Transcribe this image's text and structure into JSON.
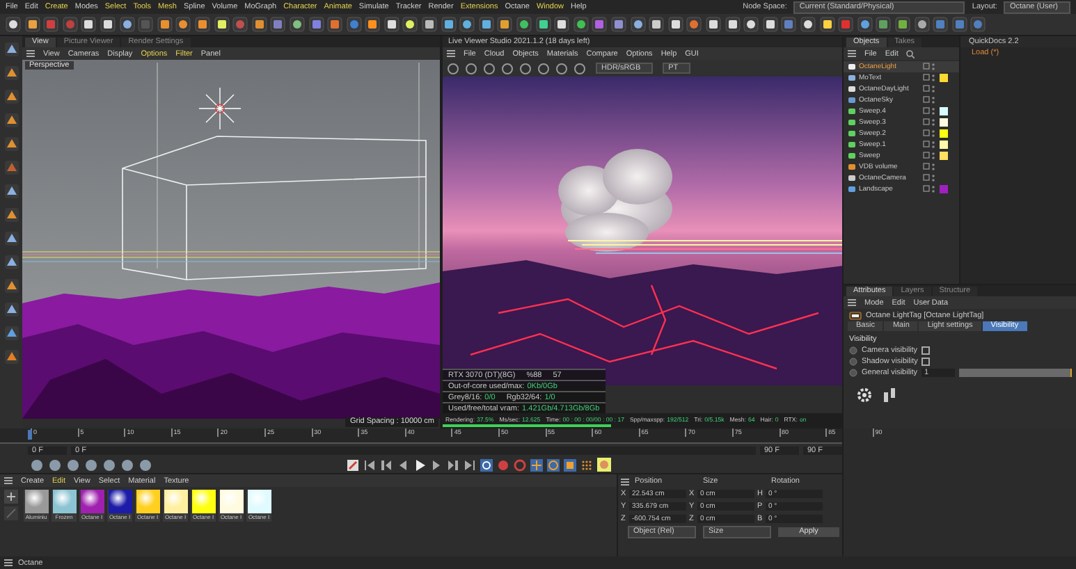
{
  "menu_bar": {
    "items": [
      {
        "label": "File",
        "highlighted": false
      },
      {
        "label": "Edit",
        "highlighted": false
      },
      {
        "label": "Create",
        "highlighted": true
      },
      {
        "label": "Modes",
        "highlighted": false
      },
      {
        "label": "Select",
        "highlighted": true
      },
      {
        "label": "Tools",
        "highlighted": true
      },
      {
        "label": "Mesh",
        "highlighted": true
      },
      {
        "label": "Spline",
        "highlighted": false
      },
      {
        "label": "Volume",
        "highlighted": false
      },
      {
        "label": "MoGraph",
        "highlighted": false
      },
      {
        "label": "Character",
        "highlighted": true
      },
      {
        "label": "Animate",
        "highlighted": true
      },
      {
        "label": "Simulate",
        "highlighted": false
      },
      {
        "label": "Tracker",
        "highlighted": false
      },
      {
        "label": "Render",
        "highlighted": false
      },
      {
        "label": "Extensions",
        "highlighted": true
      },
      {
        "label": "Octane",
        "highlighted": false
      },
      {
        "label": "Window",
        "highlighted": true
      },
      {
        "label": "Help",
        "highlighted": false
      }
    ],
    "node_space": {
      "label": "Node Space:",
      "value": "Current (Standard/Physical)"
    },
    "layout": {
      "label": "Layout:",
      "value": "Octane (User)"
    }
  },
  "viewport": {
    "tabs": [
      {
        "label": "View",
        "selected": true
      },
      {
        "label": "Picture Viewer",
        "selected": false
      },
      {
        "label": "Render Settings",
        "selected": false
      }
    ],
    "menu": [
      {
        "label": "View",
        "highlighted": false
      },
      {
        "label": "Cameras",
        "highlighted": false
      },
      {
        "label": "Display",
        "highlighted": false
      },
      {
        "label": "Options",
        "highlighted": true
      },
      {
        "label": "Filter",
        "highlighted": true
      },
      {
        "label": "Panel",
        "highlighted": false
      }
    ],
    "camera": "Perspective",
    "grid_spacing": "Grid Spacing : 10000 cm"
  },
  "live_viewer": {
    "title": "Live Viewer Studio 2021.1.2 (18 days left)",
    "menu": [
      "File",
      "Cloud",
      "Objects",
      "Materials",
      "Compare",
      "Options",
      "Help",
      "GUI"
    ],
    "color_mode": "HDR/sRGB",
    "kernel": "PT",
    "stats": [
      {
        "cells": [
          {
            "label": "RTX 3070 (DT)(8G)"
          },
          {
            "label": "%88"
          },
          {
            "label": "57"
          }
        ]
      },
      {
        "cells": [
          {
            "label": "Out-of-core used/max:",
            "value": "0Kb/0Gb"
          }
        ]
      },
      {
        "cells": [
          {
            "label": "Grey8/16:",
            "value": "0/0"
          },
          {
            "label": "Rgb32/64:",
            "value": "1/0"
          }
        ]
      },
      {
        "cells": [
          {
            "label": "Used/free/total vram:",
            "value": "1.421Gb/4.713Gb/8Gb"
          }
        ]
      }
    ],
    "status": [
      {
        "label": "Rendering:",
        "value": "37.5%"
      },
      {
        "label": "Ms/sec:",
        "value": "12.625"
      },
      {
        "label": "Time:",
        "value": "00 : 00 : 00/00 : 00 : 17"
      },
      {
        "label": "Spp/maxspp:",
        "value": "192/512"
      },
      {
        "label": "Tri:",
        "value": "0/5.15k"
      },
      {
        "label": "Mesh:",
        "value": "64"
      },
      {
        "label": "Hair:",
        "value": "0"
      },
      {
        "label": "RTX:",
        "value": "on"
      }
    ],
    "progress": {
      "level": 0.42
    }
  },
  "objects": {
    "tabs": [
      {
        "label": "Objects",
        "selected": true
      },
      {
        "label": "Takes",
        "selected": false
      }
    ],
    "menu": [
      "File",
      "Edit"
    ],
    "items": [
      {
        "name": "OctaneLight",
        "selected": true,
        "kind": "light"
      },
      {
        "name": "MoText",
        "selected": false,
        "kind": "text",
        "color": "#ffd830"
      },
      {
        "name": "OctaneDayLight",
        "selected": false,
        "kind": "daylight"
      },
      {
        "name": "OctaneSky",
        "selected": false,
        "kind": "sky"
      },
      {
        "name": "Sweep.4",
        "selected": false,
        "kind": "sweep",
        "color": "#d8fbff"
      },
      {
        "name": "Sweep.3",
        "selected": false,
        "kind": "sweep",
        "color": "#fffbe0"
      },
      {
        "name": "Sweep.2",
        "selected": false,
        "kind": "sweep",
        "color": "#ffff10"
      },
      {
        "name": "Sweep.1",
        "selected": false,
        "kind": "sweep",
        "color": "#fff8a8"
      },
      {
        "name": "Sweep",
        "selected": false,
        "kind": "sweep",
        "color": "#ffe060"
      },
      {
        "name": "VDB volume",
        "selected": false,
        "kind": "volume"
      },
      {
        "name": "OctaneCamera",
        "selected": false,
        "kind": "camera"
      },
      {
        "name": "Landscape",
        "selected": false,
        "kind": "landscape",
        "color": "#a020c0"
      }
    ]
  },
  "quickdocs": {
    "title": "QuickDocs 2.2",
    "items": [
      "Load (*)"
    ]
  },
  "attributes": {
    "tabs": [
      {
        "label": "Attributes",
        "selected": true
      },
      {
        "label": "Layers",
        "selected": false
      },
      {
        "label": "Structure",
        "selected": false
      }
    ],
    "menu": [
      "Mode",
      "Edit",
      "User Data"
    ],
    "title": "Octane LightTag [Octane LightTag]",
    "subtabs": [
      {
        "label": "Basic",
        "selected": false
      },
      {
        "label": "Main",
        "selected": false
      },
      {
        "label": "Light settings",
        "selected": false
      },
      {
        "label": "Visibility",
        "selected": true
      }
    ],
    "section": "Visibility",
    "rows": [
      {
        "kind": "checkbox",
        "label": "Camera visibility",
        "checked": false
      },
      {
        "kind": "checkbox",
        "label": "Shadow visibility",
        "checked": false
      },
      {
        "kind": "slider",
        "label": "General visibility",
        "value": "1",
        "level": 1
      }
    ]
  },
  "timeline": {
    "ticks": [
      "0",
      "5",
      "10",
      "15",
      "20",
      "25",
      "30",
      "35",
      "40",
      "45",
      "50",
      "55",
      "60",
      "65",
      "70",
      "75",
      "80",
      "85",
      "90"
    ],
    "start": "0 F",
    "current": "0 F",
    "end": "90 F",
    "max": "90 F"
  },
  "materials": {
    "menu": [
      {
        "label": "Create",
        "highlighted": false
      },
      {
        "label": "Edit",
        "highlighted": true
      },
      {
        "label": "View",
        "highlighted": false
      },
      {
        "label": "Select",
        "highlighted": false
      },
      {
        "label": "Material",
        "highlighted": false
      },
      {
        "label": "Texture",
        "highlighted": false
      }
    ],
    "items": [
      {
        "name": "Aluminiu",
        "color": "#9a9a9a"
      },
      {
        "name": "Frozen",
        "color": "#8cc4d4"
      },
      {
        "name": "Octane I",
        "color": "#a020b0"
      },
      {
        "name": "Octane I",
        "color": "#1c1ca8"
      },
      {
        "name": "Octane I",
        "color": "#ffd020"
      },
      {
        "name": "Octane I",
        "color": "#fff0a0"
      },
      {
        "name": "Octane I",
        "color": "#ffff10"
      },
      {
        "name": "Octane I",
        "color": "#fffbe0"
      },
      {
        "name": "Octane I",
        "color": "#e0fbff"
      }
    ]
  },
  "coordinates": {
    "headers": [
      "Position",
      "Size",
      "Rotation"
    ],
    "rows": [
      {
        "axis": "X",
        "position": "22.543 cm",
        "size_axis": "X",
        "size": "0 cm",
        "rot_axis": "H",
        "rotation": "0 °"
      },
      {
        "axis": "Y",
        "position": "335.679 cm",
        "size_axis": "Y",
        "size": "0 cm",
        "rot_axis": "P",
        "rotation": "0 °"
      },
      {
        "axis": "Z",
        "position": "-600.754 cm",
        "size_axis": "Z",
        "size": "0 cm",
        "rot_axis": "B",
        "rotation": "0 °"
      }
    ],
    "mode": "Object (Rel)",
    "size_mode": "Size",
    "apply": "Apply"
  },
  "status_bar": "Octane"
}
